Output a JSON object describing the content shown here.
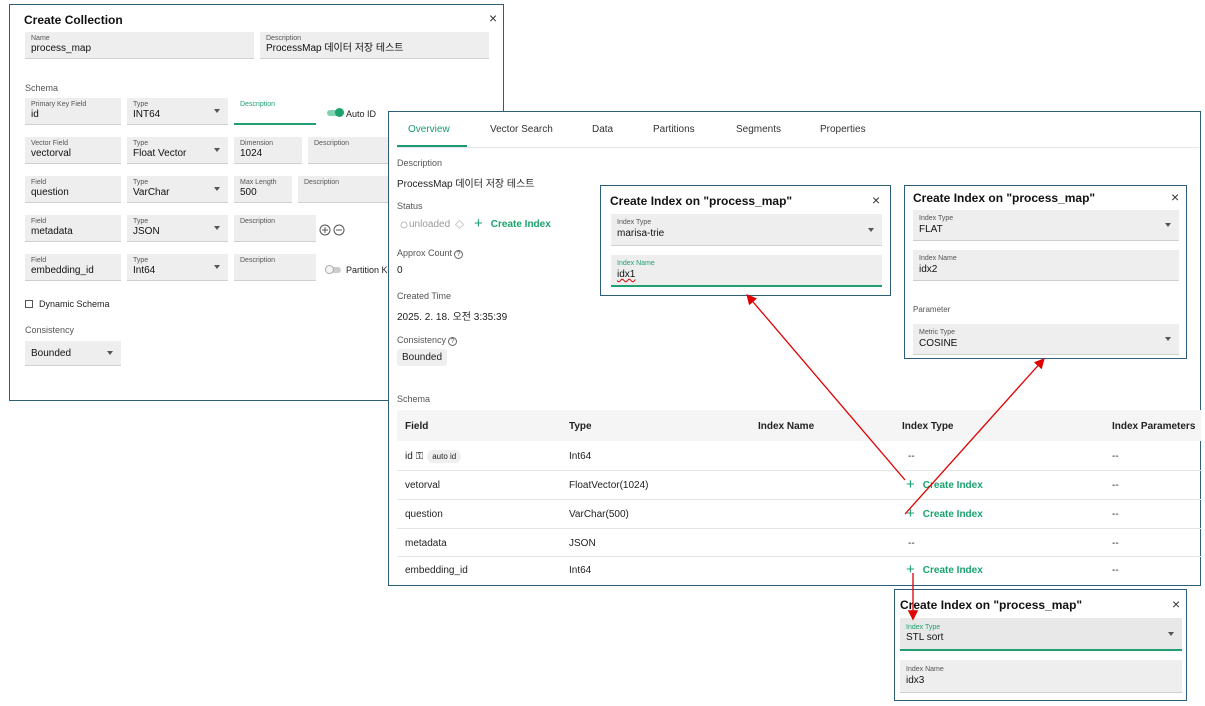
{
  "create_collection": {
    "title": "Create Collection",
    "close": "×",
    "name_label": "Name",
    "name_value": "process_map",
    "desc_label": "Description",
    "desc_value": "ProcessMap 데이터 저장 테스트",
    "schema_label": "Schema",
    "rows": [
      {
        "f_label": "Primary Key Field",
        "f_value": "id",
        "t_label": "Type",
        "t_value": "INT64",
        "c_label": "Description",
        "extra": "Auto ID"
      },
      {
        "f_label": "Vector Field",
        "f_value": "vectorval",
        "t_label": "Type",
        "t_value": "Float Vector",
        "c_label": "Dimension",
        "c_value": "1024",
        "d_label": "Description"
      },
      {
        "f_label": "Field",
        "f_value": "question",
        "t_label": "Type",
        "t_value": "VarChar",
        "c_label": "Max Length",
        "c_value": "500",
        "d_label": "Description"
      },
      {
        "f_label": "Field",
        "f_value": "metadata",
        "t_label": "Type",
        "t_value": "JSON",
        "c_label": "Description"
      },
      {
        "f_label": "Field",
        "f_value": "embedding_id",
        "t_label": "Type",
        "t_value": "Int64",
        "c_label": "Description",
        "extra": "Partition Ke"
      }
    ],
    "dynamic_schema": "Dynamic Schema",
    "consistency_label": "Consistency",
    "consistency_value": "Bounded"
  },
  "overview": {
    "tabs": [
      "Overview",
      "Vector Search",
      "Data",
      "Partitions",
      "Segments",
      "Properties"
    ],
    "description_label": "Description",
    "description_value": "ProcessMap 데이터 저장 테스트",
    "status_label": "Status",
    "status_value": "unloaded",
    "create_index": "Create Index",
    "approx_label": "Approx Count",
    "approx_value": "0",
    "created_label": "Created Time",
    "created_value": "2025. 2. 18. 오전 3:35:39",
    "consistency_label": "Consistency",
    "consistency_value": "Bounded",
    "schema_label": "Schema",
    "columns": [
      "Field",
      "Type",
      "Index Name",
      "Index Type",
      "Index Parameters"
    ],
    "rows": [
      {
        "field": "id",
        "badge": "auto id",
        "type": "Int64",
        "index_type": "--",
        "params": "--"
      },
      {
        "field": "vetorval",
        "type": "FloatVector(1024)",
        "index_type": "Create Index",
        "params": "--"
      },
      {
        "field": "question",
        "type": "VarChar(500)",
        "index_type": "Create Index",
        "params": "--"
      },
      {
        "field": "metadata",
        "type": "JSON",
        "index_type": "--",
        "params": "--"
      },
      {
        "field": "embedding_id",
        "type": "Int64",
        "index_type": "Create Index",
        "params": "--"
      }
    ]
  },
  "dialog1": {
    "title": "Create Index on \"process_map\"",
    "close": "×",
    "type_label": "Index Type",
    "type_value": "marisa-trie",
    "name_label": "Index Name",
    "name_value": "idx1"
  },
  "dialog2": {
    "title": "Create Index on \"process_map\"",
    "close": "×",
    "type_label": "Index Type",
    "type_value": "FLAT",
    "name_label": "Index Name",
    "name_value": "idx2",
    "param_label": "Parameter",
    "metric_label": "Metric Type",
    "metric_value": "COSINE"
  },
  "dialog3": {
    "title": "Create Index on \"process_map\"",
    "close": "×",
    "type_label": "Index Type",
    "type_value": "STL sort",
    "name_label": "Index Name",
    "name_value": "idx3"
  },
  "colors": {
    "accent": "#1aa36e",
    "arrow": "#e00000",
    "border": "#2e5d7a"
  }
}
